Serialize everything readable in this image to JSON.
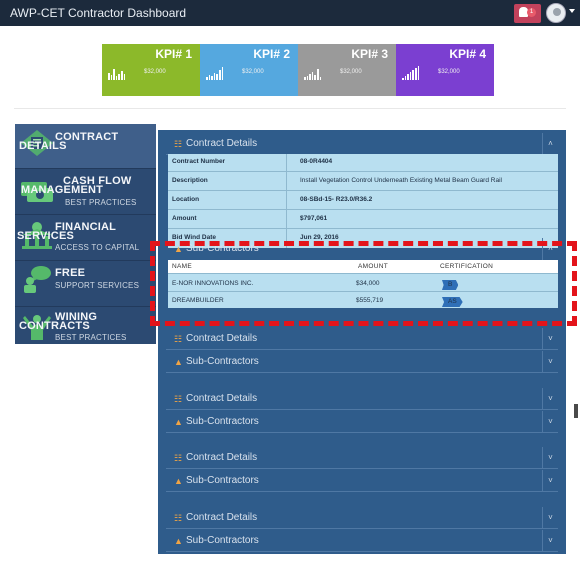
{
  "app": {
    "title": "AWP-CET Contractor Dashboard",
    "notifications": "1"
  },
  "kpis": [
    {
      "label": "KPI# 1",
      "value": "$32,000",
      "color": "#8cb92a"
    },
    {
      "label": "KPI# 2",
      "value": "$32,000",
      "color": "#55a8df"
    },
    {
      "label": "KPI# 3",
      "value": "$32,000",
      "color": "#9a9a9a"
    },
    {
      "label": "KPI# 4",
      "value": "$32,000",
      "color": "#7b3fd1"
    }
  ],
  "sidebar": {
    "items": [
      {
        "title_top": "CONTRACT",
        "title_bottom": "DETAILS",
        "sub": ""
      },
      {
        "title_top": "CASH FLOW",
        "title_bottom": "MANAGEMENT",
        "sub": "BEST PRACTICES"
      },
      {
        "title_top": "FINANCIAL",
        "title_bottom": "SERVICES",
        "sub": "ACCESS TO CAPITAL"
      },
      {
        "title_top": "FREE",
        "title_bottom": "",
        "sub": "SUPPORT SERVICES"
      },
      {
        "title_top": "WINING",
        "title_bottom": "CONTRACTS",
        "sub": "BEST PRACTICES"
      }
    ]
  },
  "contract": {
    "header_details": "Contract Details",
    "header_subs": "Sub-Contractors",
    "rows": [
      {
        "key": "Contract Number",
        "value": "08-0R4404"
      },
      {
        "key": "Description",
        "value": "Install Vegetation Control Underneath Existing Metal Beam Guard Rail"
      },
      {
        "key": "Location",
        "value": "08-SBd-15- R23.0/R36.2"
      },
      {
        "key": "Amount",
        "value": "$797,061"
      },
      {
        "key": "Bid Wind Date",
        "value": "Jun 29, 2016"
      }
    ],
    "sub_columns": [
      "NAME",
      "AMOUNT",
      "CERTIFICATION"
    ],
    "subs": [
      {
        "name": "E-NOR INNOVATIONS INC.",
        "amount": "$34,000",
        "cert": "B"
      },
      {
        "name": "DREAMBUILDER",
        "amount": "$555,719",
        "cert": "AS"
      }
    ]
  },
  "collapsed": [
    {
      "details": "Contract Details",
      "subs": "Sub-Contractors"
    },
    {
      "details": "Contract Details",
      "subs": "Sub-Contractors"
    },
    {
      "details": "Contract Details",
      "subs": "Sub-Contractors"
    },
    {
      "details": "Contract Details",
      "subs": "Sub-Contractors"
    }
  ],
  "colors": {
    "topbar": "#1c2a3c",
    "sidebar": "#2c4a72",
    "main": "#2f5c8b",
    "highlight": "#e3141b"
  }
}
